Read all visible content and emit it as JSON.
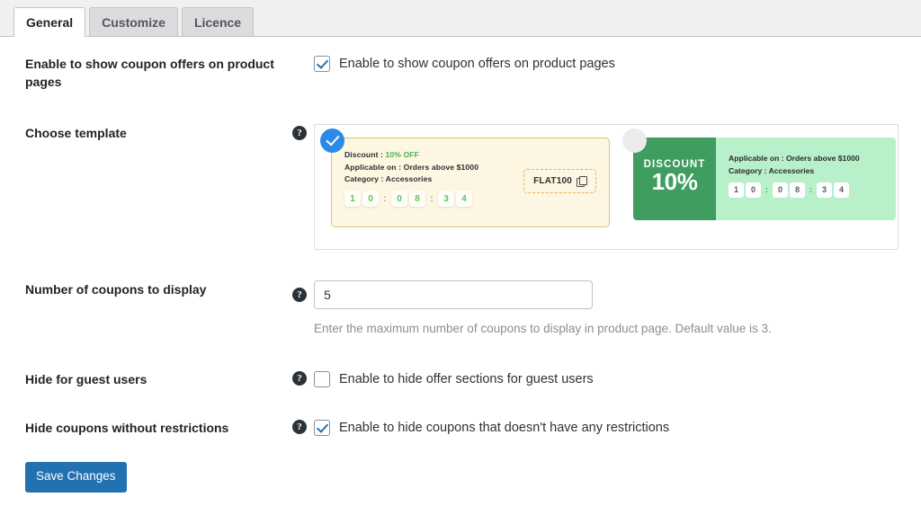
{
  "tabs": [
    {
      "label": "General",
      "active": true
    },
    {
      "label": "Customize",
      "active": false
    },
    {
      "label": "Licence",
      "active": false
    }
  ],
  "help_glyph": "?",
  "rows": {
    "enable_offers": {
      "label": "Enable to show coupon offers on product pages",
      "checkbox_label": "Enable to show coupon offers on product pages",
      "checked": true
    },
    "choose_template": {
      "label": "Choose template"
    },
    "number_of_coupons": {
      "label": "Number of coupons to display",
      "value": "5",
      "placeholder": "",
      "hint": "Enter the maximum number of coupons to display in product page. Default value is 3."
    },
    "hide_guest": {
      "label": "Hide for guest users",
      "checkbox_label": "Enable to hide offer sections for guest users",
      "checked": false
    },
    "hide_unrestricted": {
      "label": "Hide coupons without restrictions",
      "checkbox_label": "Enable to hide coupons that doesn't have any restrictions",
      "checked": true
    }
  },
  "templates": [
    {
      "id": "template-classic-yellow",
      "selected": true,
      "discount_label": "Discount : ",
      "discount_value": "10% OFF",
      "applicable": "Applicable on : Orders above $1000",
      "category": "Category : Accessories",
      "countdown": [
        "1",
        "0",
        ":",
        "0",
        "8",
        ":",
        "3",
        "4"
      ],
      "code": "FLAT100",
      "copy_icon": "copy-icon"
    },
    {
      "id": "template-badge-green",
      "selected": false,
      "discount_word": "DISCOUNT",
      "discount_percent": "10%",
      "applicable": "Applicable on : Orders above $1000",
      "category": "Category : Accessories",
      "countdown": [
        "1",
        "0",
        ":",
        "0",
        "8",
        ":",
        "3",
        "4"
      ]
    }
  ],
  "footer": {
    "save_label": "Save Changes"
  },
  "colors": {
    "accent_blue": "#2271b1",
    "select_blue": "#2b8ae8",
    "green_dark": "#3f9d5f",
    "green_light": "#b8f0ca",
    "yellow_bg": "#fdf6e3",
    "yellow_border": "#e9bd68",
    "discount_green": "#4caf50"
  }
}
